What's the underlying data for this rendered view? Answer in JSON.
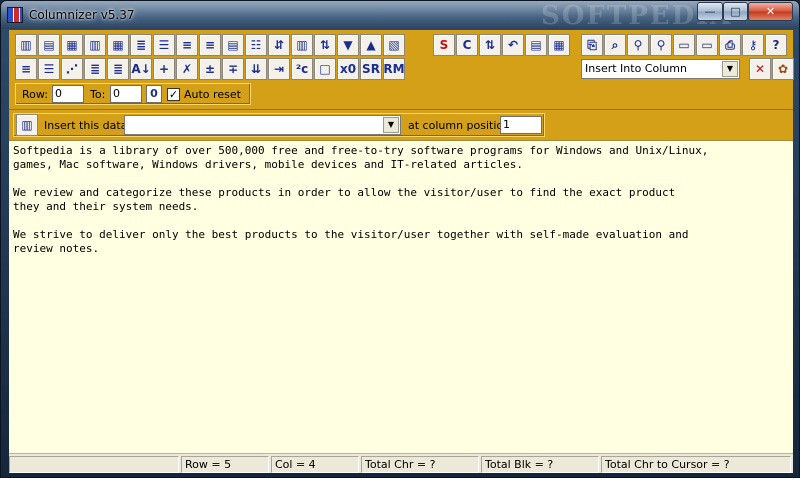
{
  "window": {
    "title": "Columnizer v5.37",
    "watermark": "SOFTPEDIA",
    "controls": {
      "minimize": "—",
      "maximize": "□",
      "close": "✕"
    }
  },
  "toolbar": {
    "row1_icons": [
      "align-columns-icon",
      "align-left-icon",
      "align-right-icon",
      "center-columns-icon",
      "split-columns-icon",
      "justify-columns-icon",
      "indent-lines-icon",
      "outdent-lines-icon",
      "justify-text-icon",
      "fill-text-icon",
      "wrap-text-icon",
      "reverse-lines-icon",
      "column-block-icon",
      "sort-column-icon",
      "sort-down-icon",
      "sort-up-icon",
      "move-column-icon"
    ],
    "row1_right_buttons": [
      {
        "name": "s-button",
        "glyph": "S",
        "color": "#c11212"
      },
      {
        "name": "c-button",
        "glyph": "C",
        "color": "#1b2d8f"
      },
      {
        "name": "swap-up-down-button",
        "glyph": "⇅",
        "color": "#1b2d8f"
      },
      {
        "name": "undo-button",
        "glyph": "↶",
        "color": "#1b2d8f"
      },
      {
        "name": "copy-button",
        "glyph": "▤",
        "color": "#1b2d8f"
      },
      {
        "name": "paste-button",
        "glyph": "▦",
        "color": "#1b2d8f"
      }
    ],
    "row1_tool_buttons": [
      {
        "name": "clipboard-button",
        "glyph": "⎘"
      },
      {
        "name": "find-replace-button",
        "glyph": "⌕"
      },
      {
        "name": "find-button",
        "glyph": "⚲"
      },
      {
        "name": "find-next-button",
        "glyph": "⚲"
      },
      {
        "name": "open-file-button",
        "glyph": "▭"
      },
      {
        "name": "open-folder-button",
        "glyph": "▭"
      },
      {
        "name": "print-button",
        "glyph": "⎙"
      },
      {
        "name": "key-button",
        "glyph": "⚷"
      },
      {
        "name": "help-button",
        "glyph": "?"
      }
    ],
    "row2_buttons": [
      {
        "name": "left-align-block-button",
        "glyph": "≡"
      },
      {
        "name": "center-block-button",
        "glyph": "☰"
      },
      {
        "name": "stagger-lines-button",
        "glyph": "⋰"
      },
      {
        "name": "dense-lines-button",
        "glyph": "≣"
      },
      {
        "name": "dense-lines-red-button",
        "glyph": "≣"
      },
      {
        "name": "sort-az-button",
        "glyph": "A↓"
      },
      {
        "name": "add-column-button",
        "glyph": "+"
      },
      {
        "name": "delete-column-button",
        "glyph": "✗"
      },
      {
        "name": "insert-row-button",
        "glyph": "±"
      },
      {
        "name": "remove-row-button",
        "glyph": "∓"
      },
      {
        "name": "shift-down-button",
        "glyph": "⇊"
      },
      {
        "name": "tab-convert-button",
        "glyph": "⇥"
      },
      {
        "name": "replace-chars-button",
        "glyph": "²c"
      },
      {
        "name": "blank-button",
        "glyph": "□"
      },
      {
        "name": "replace-zero-button",
        "glyph": "x0"
      },
      {
        "name": "sr-button",
        "glyph": "SR"
      },
      {
        "name": "rm-button",
        "glyph": "RM"
      }
    ],
    "mode_select": {
      "value": "Insert Into Column"
    },
    "cancel_glyph": "✕",
    "palette_glyph": "✿"
  },
  "row_controls": {
    "row_label": "Row:",
    "row_value": "0",
    "to_label": "To:",
    "to_value": "0",
    "zero_button": "0",
    "auto_reset_label": "Auto reset",
    "auto_reset_checked": "✓"
  },
  "insert_panel": {
    "label": "Insert this data:",
    "data_value": "",
    "position_label": "at column position:",
    "position_value": "1"
  },
  "editor": {
    "paragraphs": [
      "Softpedia is a library of over 500,000 free and free-to-try software programs for Windows and Unix/Linux,\ngames, Mac software, Windows drivers, mobile devices and IT-related articles.",
      "We review and categorize these products in order to allow the visitor/user to find the exact product\nthey and their system needs.",
      "We strive to deliver only the best products to the visitor/user together with self-made evaluation and\nreview notes."
    ]
  },
  "status": {
    "row": "Row = 5",
    "col": "Col = 4",
    "total_chr": "Total Chr = ?",
    "total_blk": "Total Blk = ?",
    "total_chr_cursor": "Total Chr to Cursor = ?"
  }
}
